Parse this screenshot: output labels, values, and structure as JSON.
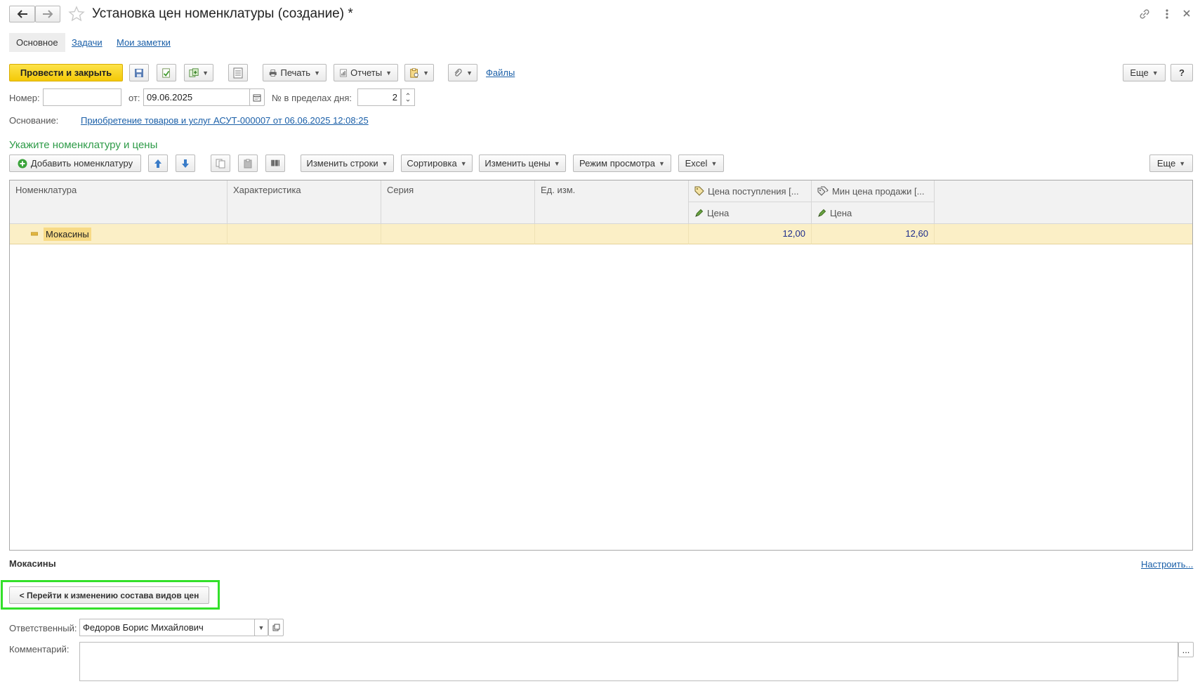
{
  "window": {
    "title": "Установка цен номенклатуры (создание) *",
    "tabs": [
      {
        "label": "Основное"
      },
      {
        "label": "Задачи"
      },
      {
        "label": "Мои заметки"
      }
    ]
  },
  "toolbar": {
    "post_close": "Провести и закрыть",
    "print": "Печать",
    "reports": "Отчеты",
    "files": "Файлы",
    "more": "Еще",
    "help": "?"
  },
  "header_fields": {
    "number_label": "Номер:",
    "number_value": "",
    "date_label": "от:",
    "date_value": "09.06.2025",
    "day_num_label": "№ в пределах дня:",
    "day_num_value": "2",
    "basis_label": "Основание:",
    "basis_link": "Приобретение товаров и услуг АСУТ-000007 от 06.06.2025 12:08:25"
  },
  "section": {
    "title": "Укажите номенклатуру и цены",
    "add_item": "Добавить номенклатуру",
    "change_rows": "Изменить строки",
    "sort": "Сортировка",
    "change_prices": "Изменить цены",
    "view_mode": "Режим просмотра",
    "excel": "Excel",
    "more": "Еще"
  },
  "table": {
    "columns": {
      "nomenclature": "Номенклатура",
      "characteristic": "Характеристика",
      "series": "Серия",
      "unit": "Ед. изм.",
      "purchase_price": "Цена поступления [...",
      "purchase_price_sub": "Цена",
      "min_sale_price": "Мин цена продажи [...",
      "min_sale_price_sub": "Цена"
    },
    "rows": [
      {
        "nomenclature": "Мокасины",
        "characteristic": "",
        "series": "",
        "unit": "",
        "purchase_price": "12,00",
        "min_sale_price": "12,60"
      }
    ]
  },
  "footer": {
    "current_item": "Мокасины",
    "configure": "Настроить...",
    "go_to_price_types": "< Перейти к изменению состава видов цен",
    "responsible_label": "Ответственный:",
    "responsible_value": "Федоров Борис Михайлович",
    "comment_label": "Комментарий:",
    "comment_value": "",
    "comment_button": "..."
  },
  "colors": {
    "accent_yellow": "#f4c907",
    "section_title": "#2e9b48",
    "selected_row": "#fbefc6",
    "highlight_frame": "#33e02a",
    "link": "#1a5fa8"
  }
}
